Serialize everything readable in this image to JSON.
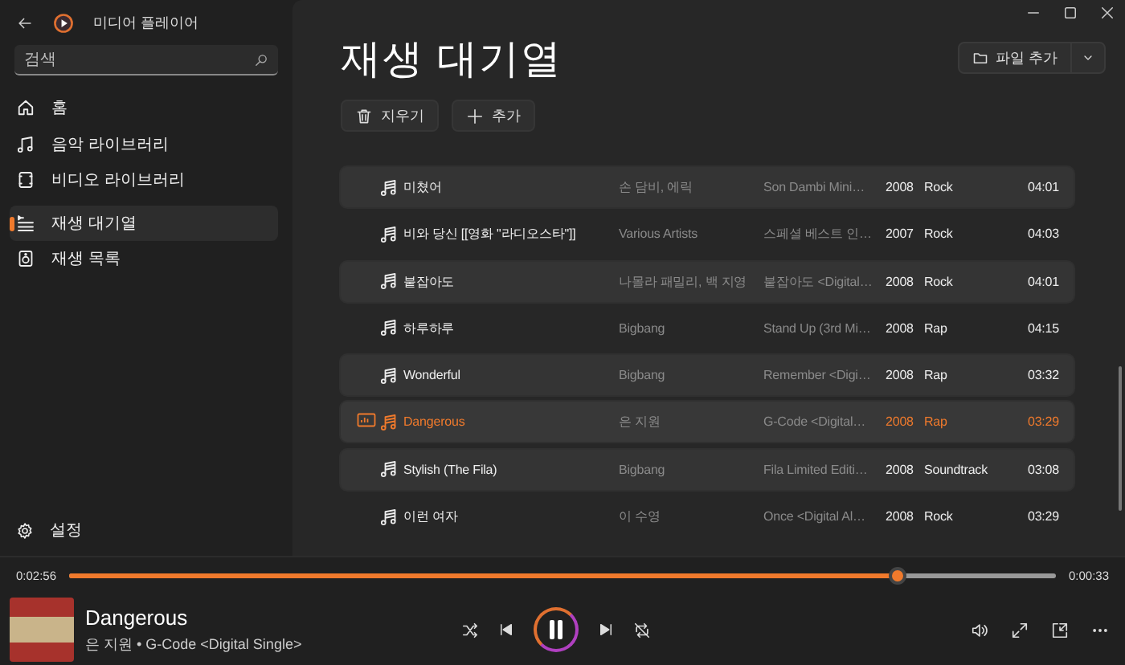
{
  "window": {
    "app_name": "미디어 플레이어"
  },
  "sidebar": {
    "search": {
      "placeholder": "검색"
    },
    "items": [
      {
        "label": "홈",
        "kind": "home",
        "selected": false
      },
      {
        "label": "음악 라이브러리",
        "kind": "music",
        "selected": false
      },
      {
        "label": "비디오 라이브러리",
        "kind": "video",
        "selected": false
      },
      {
        "label": "재생 대기열",
        "kind": "queue",
        "selected": true
      },
      {
        "label": "재생 목록",
        "kind": "playlist",
        "selected": false
      }
    ],
    "settings": "설정"
  },
  "page": {
    "title": "재생 대기열",
    "add_files": "파일 추가",
    "toolbar": [
      {
        "label": "지우기",
        "kind": "clear"
      },
      {
        "label": "추가",
        "kind": "add"
      }
    ]
  },
  "queue": [
    {
      "title": "미쳤어",
      "artist": "손 담비, 에릭",
      "album": "Son Dambi Mini…",
      "year": "2008",
      "genre": "Rock",
      "duration": "04:01",
      "shaded": true,
      "playing": false
    },
    {
      "title": "비와 당신 [[영화 \"라디오스타\"]]",
      "artist": "Various Artists",
      "album": "스페셜 베스트 인…",
      "year": "2007",
      "genre": "Rock",
      "duration": "04:03",
      "shaded": false,
      "playing": false
    },
    {
      "title": "붙잡아도",
      "artist": "나몰라 패밀리, 백 지영",
      "album": "붙잡아도 <Digital…",
      "year": "2008",
      "genre": "Rock",
      "duration": "04:01",
      "shaded": true,
      "playing": false
    },
    {
      "title": "하루하루",
      "artist": "Bigbang",
      "album": "Stand Up (3rd Mi…",
      "year": "2008",
      "genre": "Rap",
      "duration": "04:15",
      "shaded": false,
      "playing": false
    },
    {
      "title": "Wonderful",
      "artist": "Bigbang",
      "album": "Remember <Digi…",
      "year": "2008",
      "genre": "Rap",
      "duration": "03:32",
      "shaded": true,
      "playing": false
    },
    {
      "title": "Dangerous",
      "artist": "은 지원",
      "album": "G-Code <Digital…",
      "year": "2008",
      "genre": "Rap",
      "duration": "03:29",
      "shaded": true,
      "playing": true
    },
    {
      "title": "Stylish (The Fila)",
      "artist": "Bigbang",
      "album": "Fila Limited Editi…",
      "year": "2008",
      "genre": "Soundtrack",
      "duration": "03:08",
      "shaded": true,
      "playing": false
    },
    {
      "title": "이런 여자",
      "artist": "이 수영",
      "album": "Once <Digital Al…",
      "year": "2008",
      "genre": "Rock",
      "duration": "03:29",
      "shaded": false,
      "playing": false
    }
  ],
  "player": {
    "elapsed": "0:02:56",
    "remaining": "0:00:33",
    "level": 0.84,
    "title": "Dangerous",
    "subtitle": "은 지원 • G-Code <Digital Single>",
    "playing": true
  }
}
